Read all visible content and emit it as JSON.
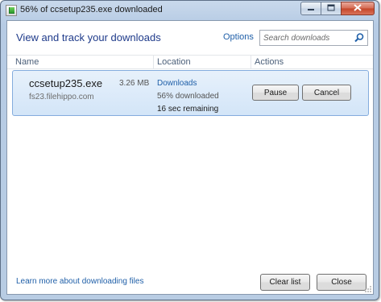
{
  "window": {
    "title": "56% of ccsetup235.exe downloaded",
    "controls": {
      "minimize_icon": "minimize-icon",
      "maximize_icon": "maximize-icon",
      "close_icon": "close-icon"
    }
  },
  "header": {
    "heading": "View and track your downloads",
    "options_label": "Options",
    "search_placeholder": "Search downloads"
  },
  "columns": {
    "name": "Name",
    "location": "Location",
    "actions": "Actions"
  },
  "downloads": [
    {
      "file_name": "ccsetup235.exe",
      "size": "3.26 MB",
      "source": "fs23.filehippo.com",
      "location": "Downloads",
      "progress_text": "56% downloaded",
      "progress": 0.56,
      "remaining": "16 sec remaining",
      "actions": {
        "pause_label": "Pause",
        "cancel_label": "Cancel"
      }
    }
  ],
  "footer": {
    "learn_more": "Learn more about downloading files",
    "clear_list_label": "Clear list",
    "close_label": "Close"
  },
  "colors": {
    "link": "#1f5fa8",
    "heading": "#1e3a8a",
    "row_highlight": "#d3e5f8",
    "row_border": "#84acdd"
  }
}
